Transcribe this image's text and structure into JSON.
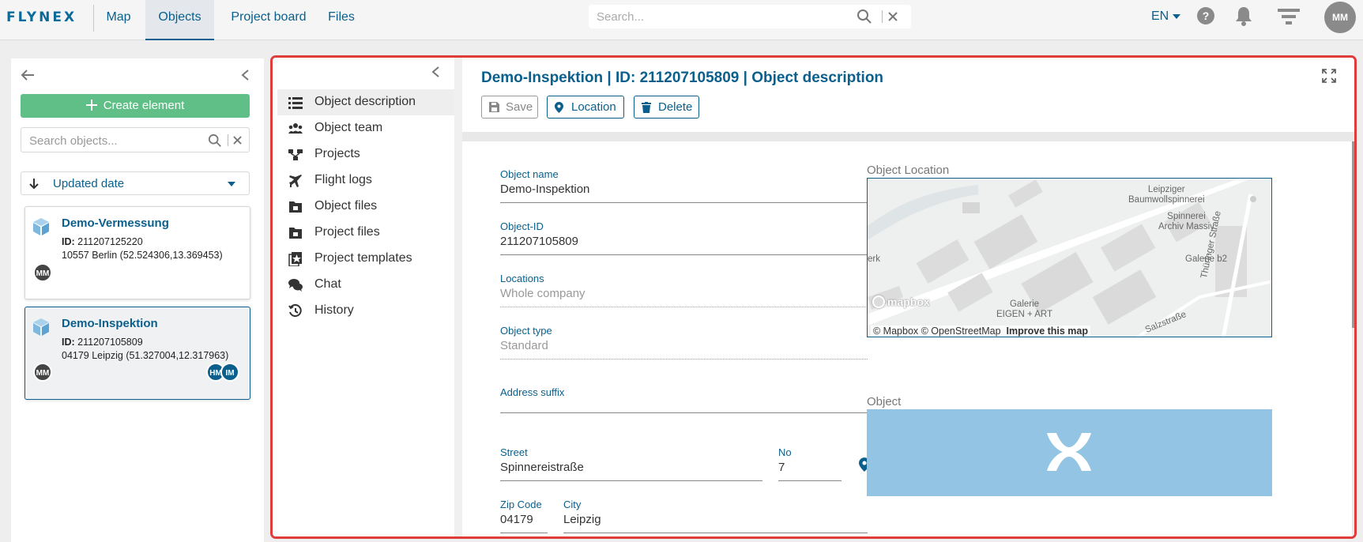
{
  "topbar": {
    "logo": "FLYNEX",
    "nav": [
      {
        "label": "Map"
      },
      {
        "label": "Objects"
      },
      {
        "label": "Project board"
      },
      {
        "label": "Files"
      }
    ],
    "active_nav": "Objects",
    "search_placeholder": "Search...",
    "language": "EN",
    "user_initials": "MM"
  },
  "left": {
    "create_label": "Create element",
    "search_placeholder": "Search objects...",
    "sort_label": "Updated date",
    "cards": [
      {
        "title": "Demo-Vermessung",
        "id_label": "ID:",
        "id": "211207125220",
        "location": "10557 Berlin (52.524306,13.369453)",
        "owner": "MM",
        "team": []
      },
      {
        "title": "Demo-Inspektion",
        "id_label": "ID:",
        "id": "211207105809",
        "location": "04179 Leipzig (51.327004,12.317963)",
        "owner": "MM",
        "team": [
          "HM",
          "IM"
        ]
      }
    ]
  },
  "menu": {
    "items": [
      {
        "label": "Object description",
        "icon": "list-icon"
      },
      {
        "label": "Object team",
        "icon": "team-icon"
      },
      {
        "label": "Projects",
        "icon": "projects-icon"
      },
      {
        "label": "Flight logs",
        "icon": "plane-icon"
      },
      {
        "label": "Object files",
        "icon": "object-files-icon"
      },
      {
        "label": "Project files",
        "icon": "project-files-icon"
      },
      {
        "label": "Project templates",
        "icon": "templates-icon"
      },
      {
        "label": "Chat",
        "icon": "chat-icon"
      },
      {
        "label": "History",
        "icon": "history-icon"
      }
    ]
  },
  "header": {
    "title": "Demo-Inspektion | ID: 211207105809 | Object description",
    "save_label": "Save",
    "location_label": "Location",
    "delete_label": "Delete"
  },
  "form": {
    "object_name": {
      "label": "Object name",
      "value": "Demo-Inspektion"
    },
    "object_id": {
      "label": "Object-ID",
      "value": "211207105809"
    },
    "locations": {
      "label": "Locations",
      "value": "Whole company"
    },
    "object_type": {
      "label": "Object type",
      "value": "Standard"
    },
    "address_suffix": {
      "label": "Address suffix",
      "value": ""
    },
    "street": {
      "label": "Street",
      "value": "Spinnereistraße"
    },
    "number": {
      "label": "No",
      "value": "7"
    },
    "zip": {
      "label": "Zip Code",
      "value": "04179"
    },
    "city": {
      "label": "City",
      "value": "Leipzig"
    }
  },
  "side": {
    "location_title": "Object Location",
    "object_title": "Object",
    "map_labels": {
      "leipziger": "Leipziger\nBaumwollspinnerei",
      "spinnerei": "Spinnerei\nArchiv Massiv",
      "galerie_b2": "Galerie b2",
      "galerie_eigen": "Galerie\nEIGEN + ART",
      "erk": "erk",
      "thueringer": "Thüringer Straße",
      "salzstrasse": "Salzstraße"
    },
    "mapbox_logo": "mapbox",
    "map_attr_prefix": "© Mapbox © OpenStreetMap",
    "map_attr_link": "Improve this map"
  },
  "colors": {
    "brand": "#0a5f8c",
    "create_button": "#5fbf86",
    "highlight_border": "#e13c3c",
    "object_image_bg": "#93c4e3"
  }
}
